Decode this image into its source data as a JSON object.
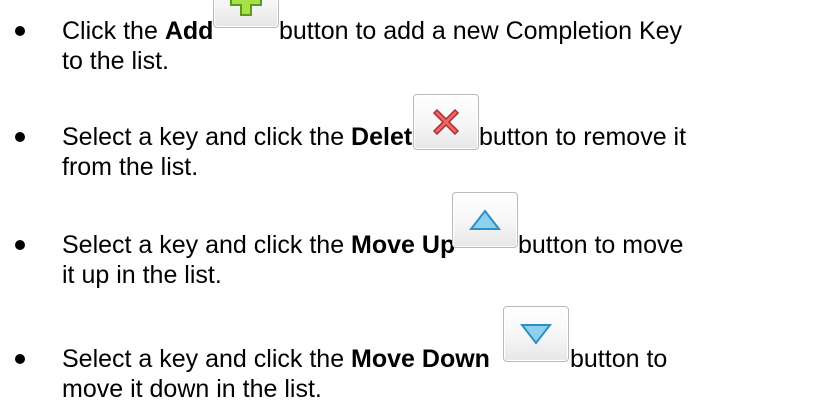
{
  "items": [
    {
      "before": "Click the ",
      "bold": "Add",
      "after": " button to add a new Completion Key",
      "line2": "to the list.",
      "icon": "add-icon"
    },
    {
      "before": "Select a key and click the ",
      "bold": "Delete",
      "after": " button to remove it",
      "line2": "from the list.",
      "icon": "delete-icon"
    },
    {
      "before": "Select a key and click the ",
      "bold": "Move Up",
      "after": " button to move",
      "line2": "it up in the list.",
      "icon": "move-up-icon"
    },
    {
      "before": "Select a key and click the ",
      "bold": "Move Down",
      "after": " button to",
      "line2": "move it down in the list.",
      "icon": "move-down-icon"
    }
  ]
}
